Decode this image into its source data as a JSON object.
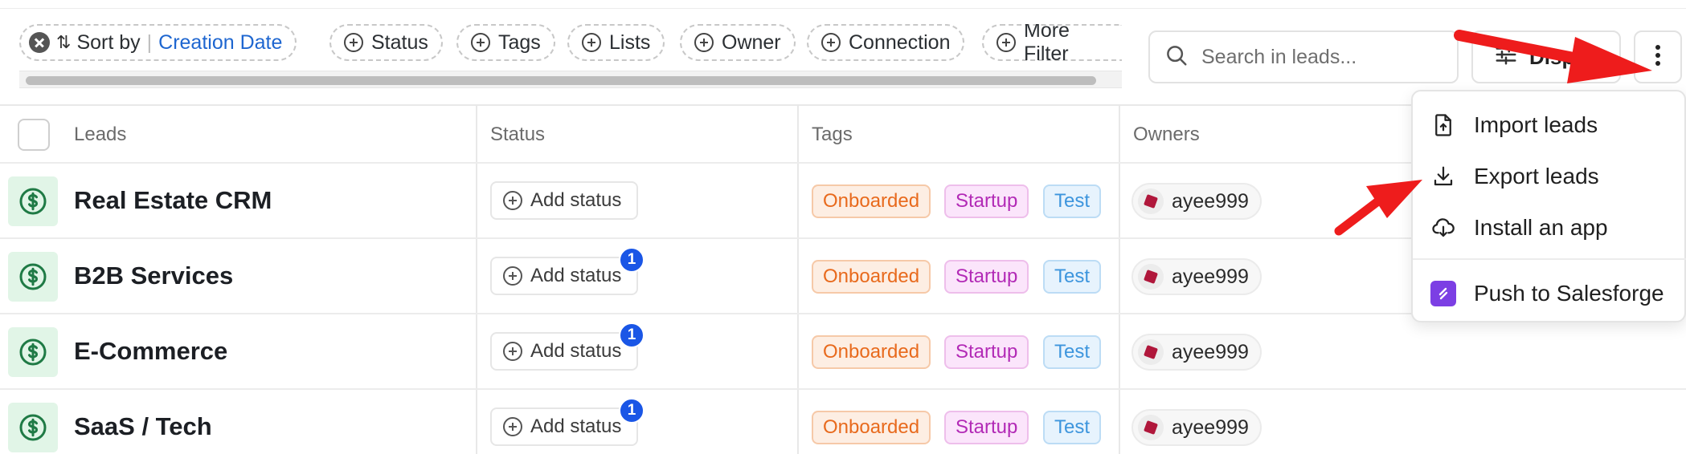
{
  "filters": {
    "sort": {
      "label": "Sort by",
      "value": "Creation Date"
    },
    "chips": [
      "Status",
      "Tags",
      "Lists",
      "Owner",
      "Connection",
      "More Filter"
    ]
  },
  "search": {
    "placeholder": "Search in leads..."
  },
  "display_button": {
    "label": "Display"
  },
  "table": {
    "headers": {
      "leads": "Leads",
      "status": "Status",
      "tags": "Tags",
      "owners": "Owners"
    },
    "rows": [
      {
        "name": "Real Estate CRM",
        "status": "Add status",
        "badge": "",
        "tags": [
          "Onboarded",
          "Startup",
          "Test"
        ],
        "owner": "ayee999"
      },
      {
        "name": "B2B Services",
        "status": "Add status",
        "badge": "1",
        "tags": [
          "Onboarded",
          "Startup",
          "Test"
        ],
        "owner": "ayee999"
      },
      {
        "name": "E-Commerce",
        "status": "Add status",
        "badge": "1",
        "tags": [
          "Onboarded",
          "Startup",
          "Test"
        ],
        "owner": "ayee999"
      },
      {
        "name": "SaaS / Tech",
        "status": "Add status",
        "badge": "1",
        "tags": [
          "Onboarded",
          "Startup",
          "Test"
        ],
        "owner": "ayee999"
      }
    ]
  },
  "menu": {
    "items": [
      "Import leads",
      "Export leads",
      "Install an app",
      "Push to Salesforge"
    ]
  },
  "colors": {
    "accent_blue": "#1e66d0",
    "badge_blue": "#1a56e6",
    "arrow_red": "#ee1c1c",
    "lead_icon_green": "#1f7a45",
    "salesforge_purple": "#7c3fe4"
  }
}
